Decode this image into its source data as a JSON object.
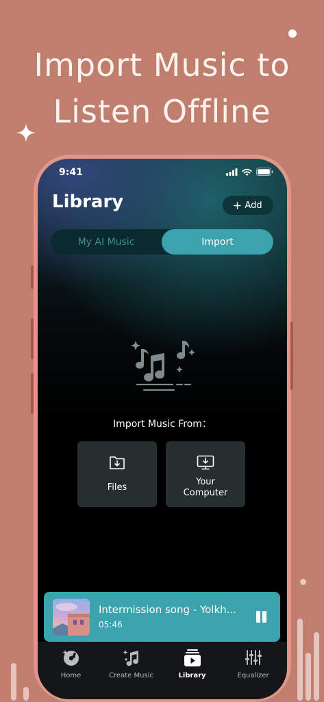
{
  "headline": {
    "line1": "Import Music to",
    "line2": "Listen Offline"
  },
  "status_bar": {
    "time": "9:41"
  },
  "library": {
    "title": "Library",
    "add_button": {
      "icon": "plus-icon",
      "label": "Add"
    },
    "tabs": [
      {
        "label": "My AI Music",
        "active": false
      },
      {
        "label": "Import",
        "active": true
      }
    ],
    "import_from_label": "Import Music From：",
    "sources": [
      {
        "icon": "folder-import-icon",
        "label": "Files"
      },
      {
        "icon": "monitor-download-icon",
        "label_line1": "Your",
        "label_line2": "Computer"
      }
    ]
  },
  "player": {
    "title": "Intermission song - Yolkh...",
    "time": "05:46",
    "state_icon": "pause-icon"
  },
  "bottom_nav": {
    "items": [
      {
        "label": "Home",
        "icon": "disc-icon",
        "active": false
      },
      {
        "label": "Create Music",
        "icon": "music-note-sparkle-icon",
        "active": false
      },
      {
        "label": "Library",
        "icon": "library-play-icon",
        "active": true
      },
      {
        "label": "Equalizer",
        "icon": "equalizer-icon",
        "active": false
      }
    ]
  },
  "colors": {
    "background": "#c07e6e",
    "accent": "#3aa3ad",
    "phone_frame": "#e0968a",
    "card": "#262e30"
  }
}
